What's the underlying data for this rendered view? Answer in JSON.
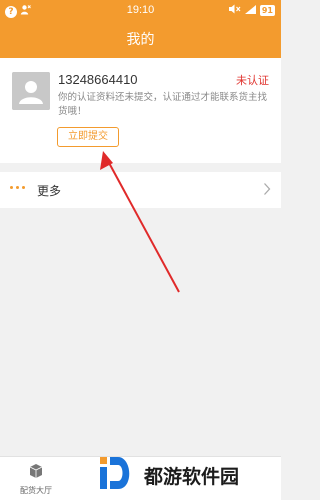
{
  "status_bar": {
    "alert_icon": "?",
    "time": "19:10",
    "battery": "91"
  },
  "header": {
    "title": "我的"
  },
  "profile": {
    "phone": "13248664410",
    "verify_status": "未认证",
    "notice": "你的认证资料还未提交，认证通过才能联系货主找货哦！",
    "submit_label": "立即提交"
  },
  "more": {
    "label": "更多"
  },
  "tab_bar": {
    "items": [
      {
        "label": "配货大厅",
        "icon": "box-icon"
      }
    ]
  },
  "watermark": {
    "text": "都游软件园"
  },
  "colors": {
    "accent": "#f39b2e",
    "alert": "#e0342f",
    "arrow": "#e02a2a"
  }
}
